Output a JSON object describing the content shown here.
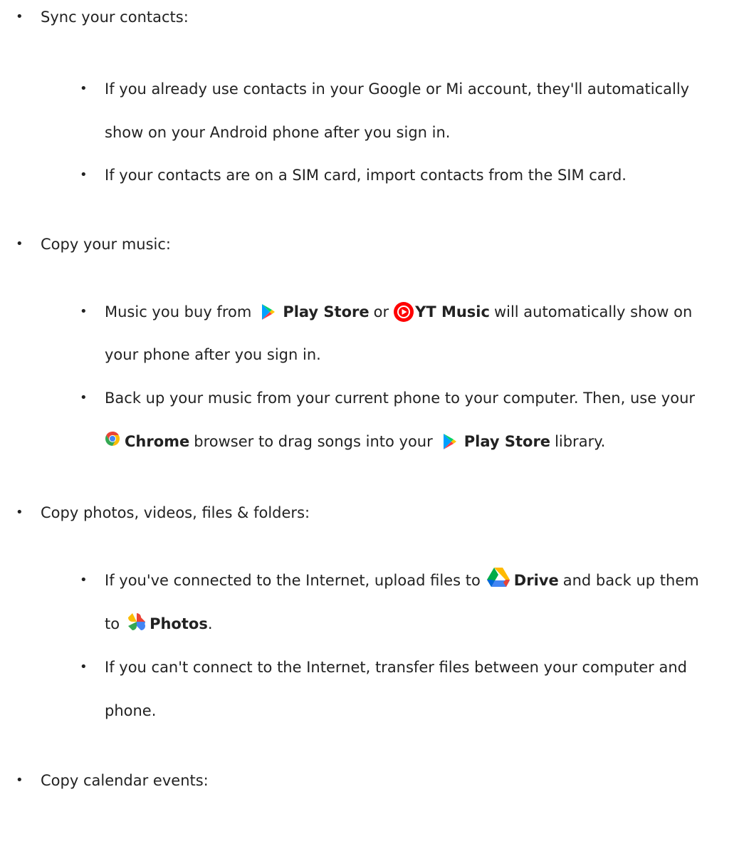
{
  "sections": [
    {
      "heading": "Sync your contacts:",
      "items": [
        {
          "line1": "If you already use contacts in your Google or Mi account, they'll automatically",
          "line2": "show on your Android phone after you sign in."
        },
        {
          "line1": "If your contacts are on a SIM card, import contacts from the SIM card."
        }
      ]
    },
    {
      "heading": "Copy your music:",
      "items": [
        {
          "pre": "Music you buy from",
          "app1": "Play Store",
          "mid": "or",
          "app2": "YT Music",
          "post": "will automatically show on",
          "line2": "your phone after you sign in."
        },
        {
          "line1": "Back up your music from your current phone to your computer. Then, use your",
          "app1": "Chrome",
          "mid": "browser to drag songs into your",
          "app2": "Play Store",
          "post": "library."
        }
      ]
    },
    {
      "heading": "Copy photos, videos, files & folders:",
      "items": [
        {
          "pre": "If you've connected to the Internet, upload files to",
          "app1": "Drive",
          "post": "and back up them",
          "line2pre": "to",
          "app2": "Photos",
          "line2post": "."
        },
        {
          "line1": "If you can't connect to the Internet, transfer files between your computer and",
          "line2": "phone."
        }
      ]
    },
    {
      "heading": "Copy calendar events:"
    }
  ],
  "bullet_char": "•",
  "icons": {
    "play_store": "play-store-icon",
    "yt_music": "yt-music-icon",
    "chrome": "chrome-icon",
    "drive": "drive-icon",
    "photos": "photos-icon"
  },
  "colors": {
    "text": "#222222",
    "yt_red": "#ff0000",
    "play_blue": "#00a0ff",
    "play_green": "#00d26a",
    "play_yellow": "#ffc400",
    "play_red": "#ff3a44"
  }
}
